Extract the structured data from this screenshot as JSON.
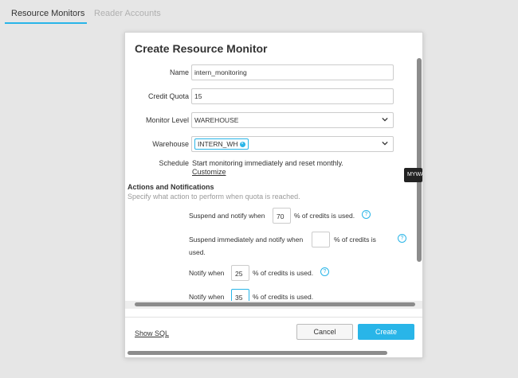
{
  "tabs": [
    {
      "label": "Resource Monitors",
      "active": true
    },
    {
      "label": "Reader Accounts",
      "active": false
    }
  ],
  "modal": {
    "title": "Create Resource Monitor",
    "name": {
      "label": "Name",
      "value": "intern_monitoring"
    },
    "credit_quota": {
      "label": "Credit Quota",
      "value": "15"
    },
    "monitor_level": {
      "label": "Monitor Level",
      "value": "WAREHOUSE"
    },
    "warehouse": {
      "label": "Warehouse",
      "chip": "INTERN_WH"
    },
    "schedule": {
      "label": "Schedule",
      "text": "Start monitoring immediately and reset monthly.",
      "link": "Customize"
    },
    "actions": {
      "title": "Actions and Notifications",
      "subtitle": "Specify what action to perform when quota is reached.",
      "rows": [
        {
          "before": "Suspend and notify when",
          "value": "70",
          "after": "% of credits is used."
        },
        {
          "before": "Suspend immediately and notify when",
          "value": "",
          "after": "% of credits is",
          "after2": "used."
        },
        {
          "before": "Notify when",
          "value": "25",
          "after": "% of credits is used."
        },
        {
          "before": "Notify when",
          "value": "35",
          "after": "% of credits is used."
        }
      ]
    },
    "footer": {
      "show_sql": "Show SQL",
      "cancel": "Cancel",
      "create": "Create"
    }
  },
  "tooltip": "MYWA",
  "colors": {
    "accent": "#29b5e8",
    "background": "#e6e6e6"
  }
}
